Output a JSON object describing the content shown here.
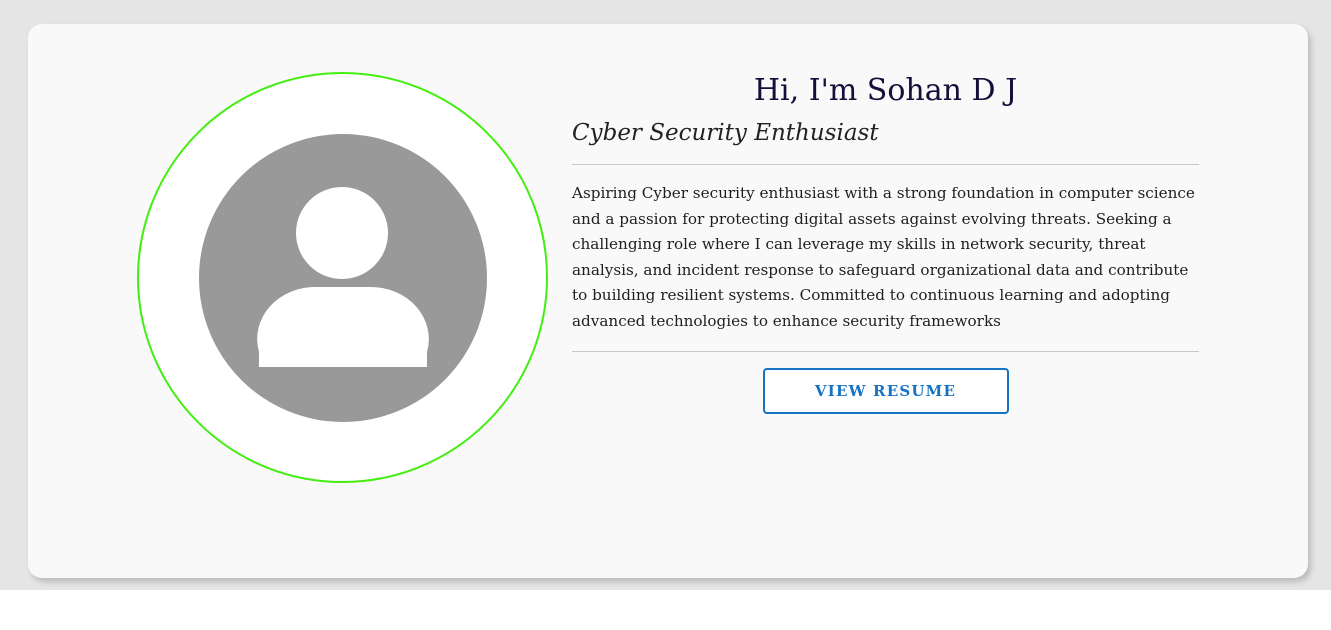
{
  "profile": {
    "greeting": "Hi, I'm Sohan D J",
    "title": "Cyber Security Enthusiast",
    "bio": "Aspiring Cyber security enthusiast with a strong foundation in computer science and a passion for protecting digital assets against evolving threats. Seeking a challenging role where I can leverage my skills in network security, threat analysis, and incident response to safeguard organizational data and contribute to building resilient systems. Committed to continuous learning and adopting advanced technologies to enhance security frameworks",
    "avatar_icon": "user-avatar-icon"
  },
  "actions": {
    "resume_label": "VIEW RESUME"
  },
  "colors": {
    "page_backdrop": "#e5e5e5",
    "card_background": "#f9f9f9",
    "avatar_ring": "#44ee11",
    "avatar_fill": "#999999",
    "heading": "#14103a",
    "button_accent": "#1673c4"
  }
}
